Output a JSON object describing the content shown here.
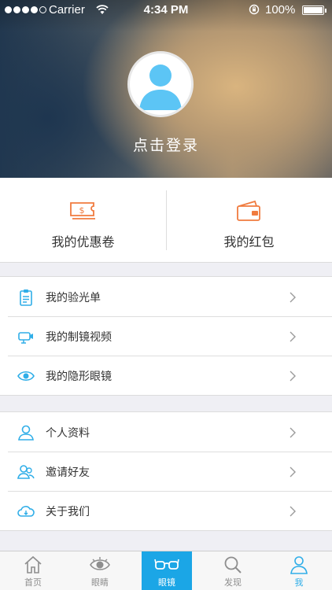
{
  "status_bar": {
    "carrier": "Carrier",
    "time": "4:34 PM",
    "battery": "100%"
  },
  "profile": {
    "login_label": "点击登录"
  },
  "wallet": {
    "coupons_label": "我的优惠卷",
    "red_packet_label": "我的红包",
    "accent_color": "#f07b3f"
  },
  "menu_group_1": {
    "items": [
      {
        "label": "我的验光单",
        "icon": "clipboard-icon"
      },
      {
        "label": "我的制镜视频",
        "icon": "video-camera-icon"
      },
      {
        "label": "我的隐形眼镜",
        "icon": "eye-icon"
      }
    ]
  },
  "menu_group_2": {
    "items": [
      {
        "label": "个人资料",
        "icon": "person-icon"
      },
      {
        "label": "邀请好友",
        "icon": "invite-friends-icon"
      },
      {
        "label": "关于我们",
        "icon": "cloud-icon"
      }
    ]
  },
  "tab_bar": {
    "tabs": [
      {
        "label": "首页",
        "icon": "home-icon"
      },
      {
        "label": "眼睛",
        "icon": "eye-icon"
      },
      {
        "label": "眼镜",
        "icon": "glasses-icon",
        "active": true
      },
      {
        "label": "发现",
        "icon": "search-icon"
      },
      {
        "label": "我",
        "icon": "person-icon",
        "selected": true
      }
    ],
    "active_color": "#1ba6e6"
  },
  "colors": {
    "icon_blue": "#30aee8",
    "chevron": "#9a9a9a"
  }
}
